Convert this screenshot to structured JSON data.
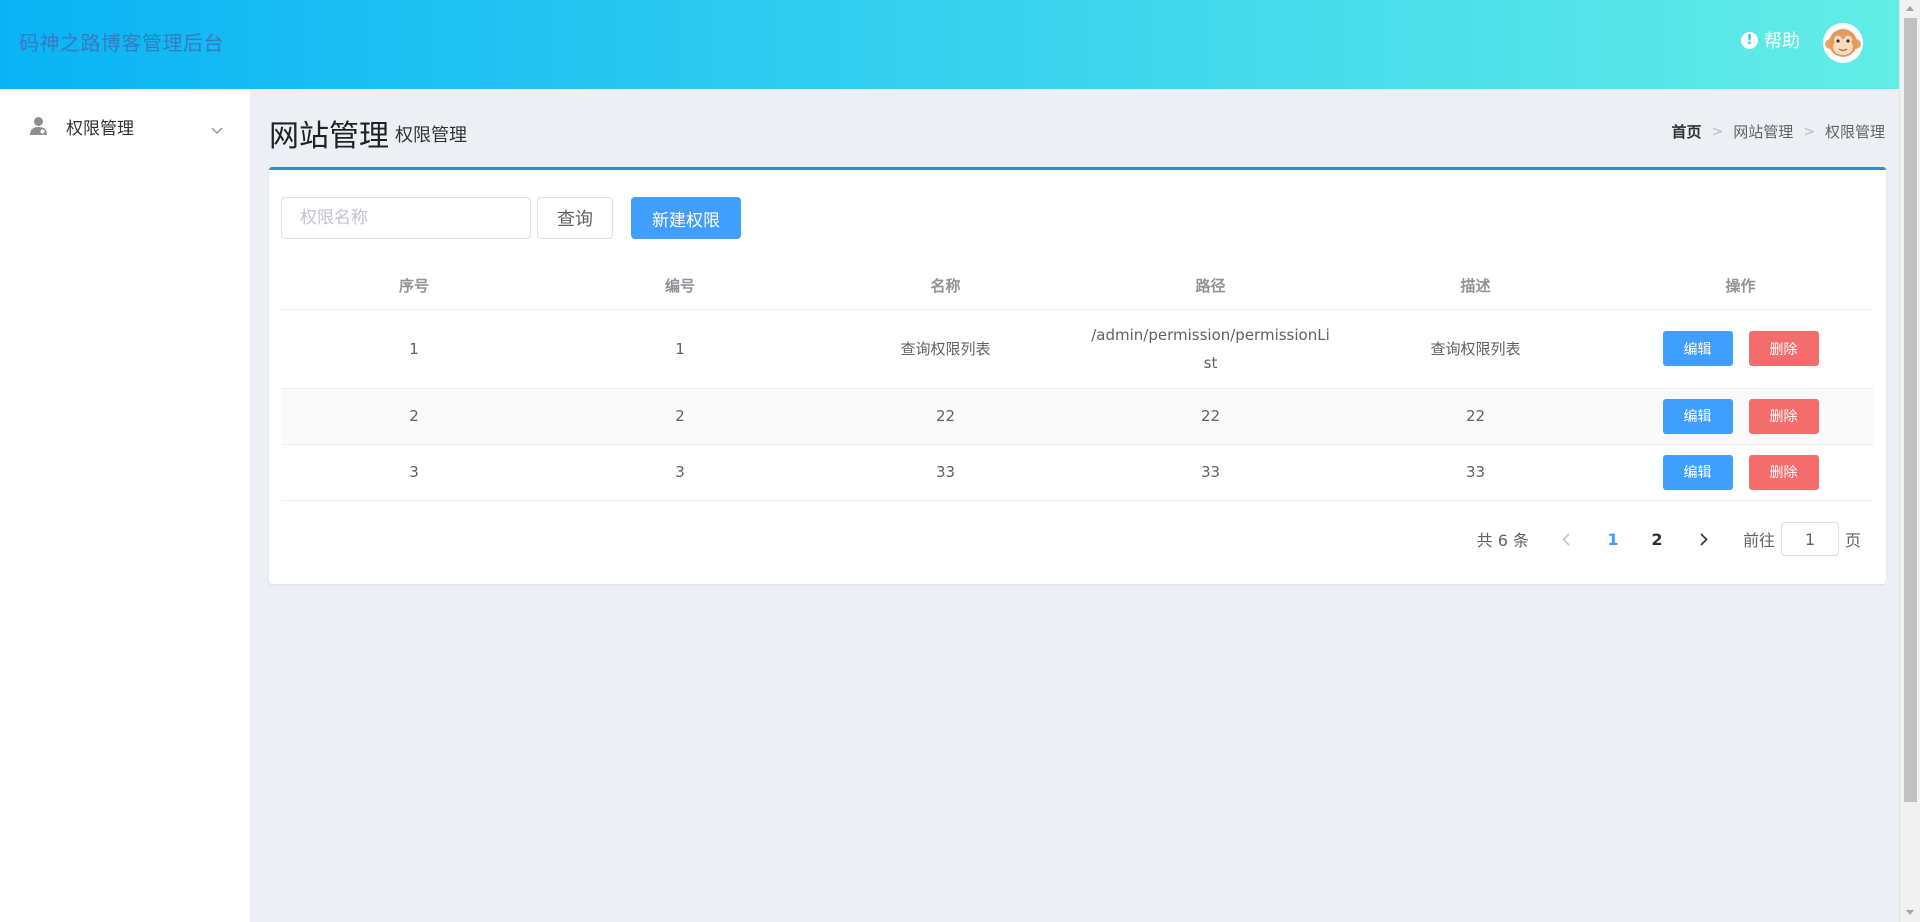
{
  "header": {
    "app_title": "码神之路博客管理后台",
    "help_label": "帮助",
    "help_icon_glyph": "!",
    "gradient_start": "#0ab3f5",
    "gradient_end": "#62ede6"
  },
  "sidebar": {
    "items": [
      {
        "label": "权限管理",
        "icon": "user-icon",
        "expanded": false
      }
    ]
  },
  "page": {
    "title": "网站管理",
    "subtitle": "权限管理"
  },
  "breadcrumb": {
    "items": [
      "首页",
      "网站管理",
      "权限管理"
    ]
  },
  "search": {
    "placeholder": "权限名称",
    "value": "",
    "query_label": "查询",
    "new_label": "新建权限"
  },
  "table": {
    "columns": [
      "序号",
      "编号",
      "名称",
      "路径",
      "描述",
      "操作"
    ],
    "rows": [
      {
        "index": "1",
        "id": "1",
        "name": "查询权限列表",
        "path": "/admin/permission/permissionList",
        "desc": "查询权限列表"
      },
      {
        "index": "2",
        "id": "2",
        "name": "22",
        "path": "22",
        "desc": "22"
      },
      {
        "index": "3",
        "id": "3",
        "name": "33",
        "path": "33",
        "desc": "33"
      }
    ],
    "edit_label": "编辑",
    "delete_label": "删除"
  },
  "pagination": {
    "total_label": "共 6 条",
    "pages": [
      "1",
      "2"
    ],
    "current_page": "1",
    "goto_prefix": "前往",
    "goto_value": "1",
    "goto_suffix": "页"
  },
  "colors": {
    "primary": "#409eff",
    "danger": "#f56c6c",
    "card_top_border": "#3c8dbc",
    "page_bg": "#ecf0f5"
  }
}
